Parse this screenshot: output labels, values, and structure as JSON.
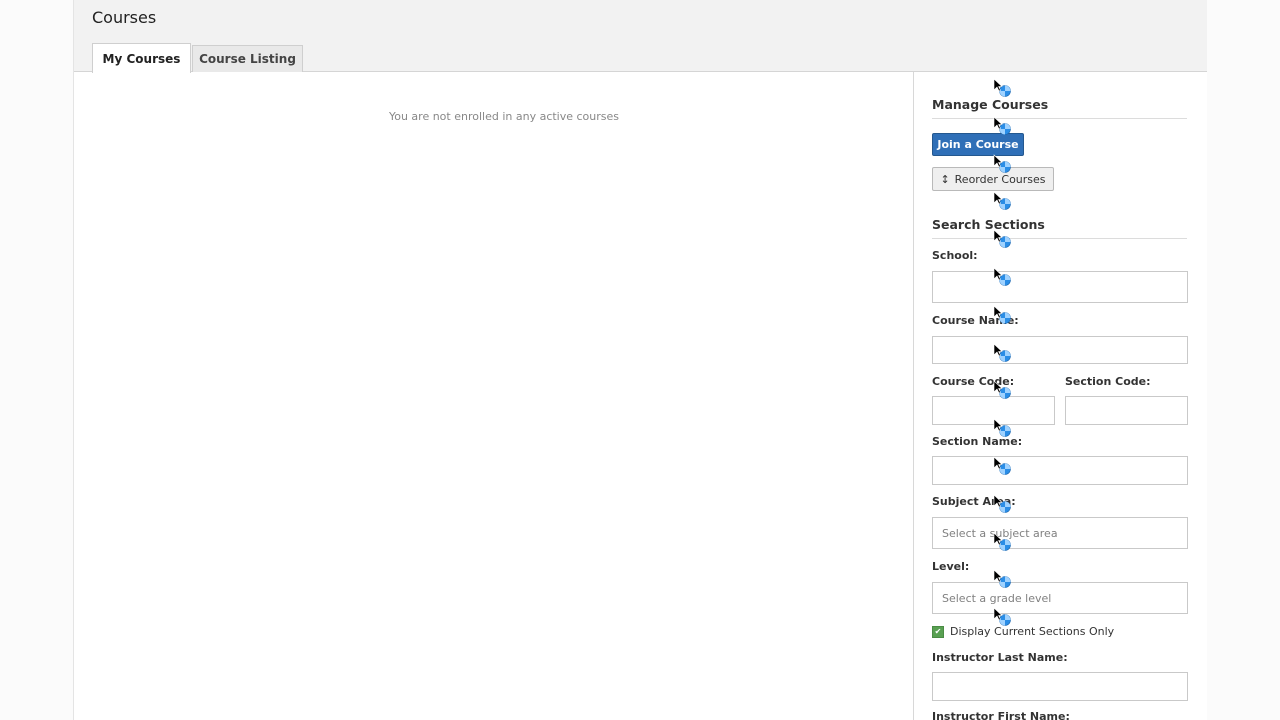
{
  "page": {
    "title": "Courses"
  },
  "tabs": [
    {
      "label": "My Courses",
      "active": true
    },
    {
      "label": "Course Listing",
      "active": false
    }
  ],
  "main": {
    "empty_message": "You are not enrolled in any active courses"
  },
  "sidebar": {
    "manage": {
      "title": "Manage Courses",
      "join_label": "Join a Course",
      "reorder_label": "Reorder Courses",
      "reorder_icon": "vertical-arrows-icon"
    },
    "search": {
      "title": "Search Sections",
      "school_label": "School:",
      "school_value": "",
      "course_name_label": "Course Name:",
      "course_name_value": "",
      "course_code_label": "Course Code:",
      "course_code_value": "",
      "section_code_label": "Section Code:",
      "section_code_value": "",
      "section_name_label": "Section Name:",
      "section_name_value": "",
      "subject_area_label": "Subject Area:",
      "subject_area_placeholder": "Select a subject area",
      "level_label": "Level:",
      "level_placeholder": "Select a grade level",
      "current_only_label": "Display Current Sections Only",
      "current_only_checked": true,
      "instructor_last_label": "Instructor Last Name:",
      "instructor_last_value": "",
      "instructor_first_label": "Instructor First Name:"
    }
  },
  "colors": {
    "primary_button": "#2f6fb7",
    "checkbox": "#59a052",
    "header_bg": "#f2f2f2"
  }
}
